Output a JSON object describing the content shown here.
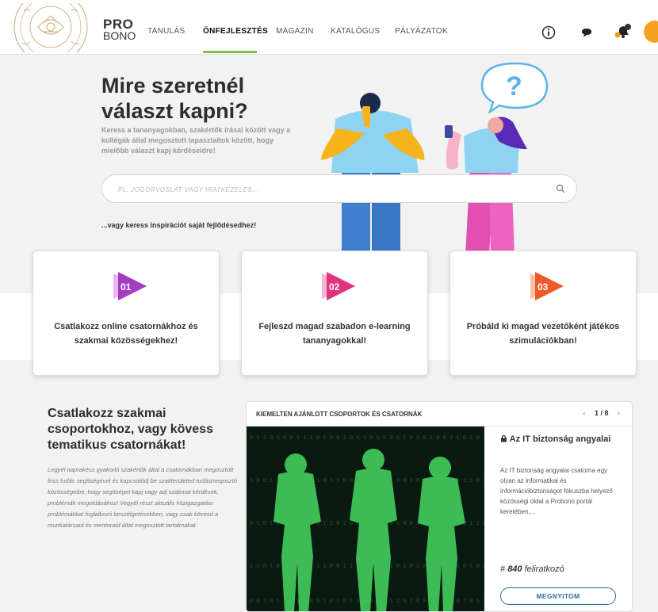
{
  "header": {
    "brand_line1": "PRO",
    "brand_line2": "BONO",
    "nav": [
      "TANULÁS",
      "ÖNFEJLESZTÉS",
      "MAGAZIN",
      "KATALÓGUS",
      "PÁLYÁZATOK"
    ],
    "active_nav": "ÖNFEJLESZTÉS",
    "icons": [
      "info-icon",
      "chat-icon",
      "bell-icon",
      "avatar"
    ],
    "notification_dot_color": "#f39c12",
    "accent_color": "#7cc246"
  },
  "hero": {
    "title": "Mire szeretnél választ kapni?",
    "subtitle": "Keress a tananyagokban, szakértők írásai között vagy a kollégák által megosztott tapasztaltok között, hogy mielőbb választ kapj kérdéseidre!",
    "search_placeholder": "PL. JOGORVOSLAT VAGY IRATKEZELÉS...",
    "inspire_text": "...vagy keress inspirációt saját fejlődésedhez!"
  },
  "cards": [
    {
      "number": "01",
      "text": "Csatlakozz online csatornákhoz és szakmai közösségekhez!",
      "color": "#a43cc4"
    },
    {
      "number": "02",
      "text": "Fejleszd magad szabadon e-learning tananyagokkal!",
      "color": "#e0357e"
    },
    {
      "number": "03",
      "text": "Próbáld ki magad vezetőként játékos szimulációkban!",
      "color": "#ef5a2a"
    }
  ],
  "section": {
    "title": "Csatlakozz szakmai csoportokhoz, vagy kövess tematikus csatornákat!",
    "body": "Legyél naprakész gyakorló szakértők által a csatornákban megosztott friss tudás segítségével és kapcsolódj be szakterületed tudásmegosztó közösségeibe, hogy segítséget kapj vagy adj szakmai kérdések, problémák megoldásához! Vegyél részt aktuális közigazgatási problémákkal foglalkozó beszélgetésekben, vagy csak kövesd a munkatársaid és mentoraid által megosztott tartalmakat."
  },
  "featured": {
    "title": "KIEMELTEN AJÁNLOTT CSOPORTOK ÉS CSATORNÁK",
    "page": "1 / 8",
    "prev": "‹",
    "next": "›",
    "channel_name": "Az IT biztonság angyalai",
    "channel_desc": "Az IT biztonság angyalai csatorna egy olyan az informatikai és információbiztonságot fókuszba helyező közösségi oldal a Probono portál keretében,...",
    "subscriber_hash": "#",
    "subscriber_count": "840",
    "subscriber_label": "feliratkozó",
    "open_button": "MEGNYITOM"
  }
}
